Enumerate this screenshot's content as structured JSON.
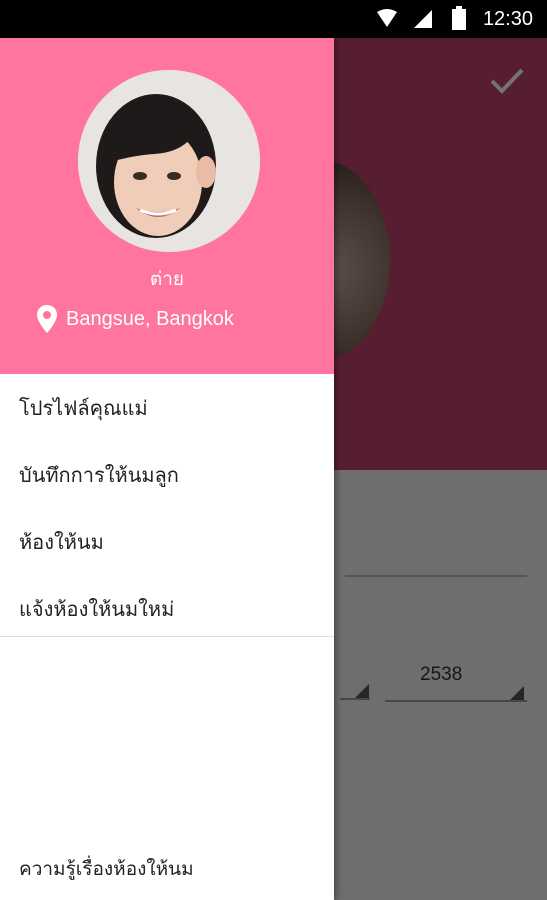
{
  "status_bar": {
    "time": "12:30"
  },
  "background": {
    "year_value": "2538"
  },
  "drawer": {
    "profile": {
      "name": "ต่าย",
      "location": "Bangsue, Bangkok"
    },
    "menu": [
      {
        "label": "โปรไฟล์คุณแม่"
      },
      {
        "label": "บันทึกการให้นมลูก"
      },
      {
        "label": "ห้องให้นม"
      },
      {
        "label": "แจ้งห้องให้นมใหม่"
      }
    ],
    "footer_item": "ความรู้เรื่องห้องให้นม"
  },
  "colors": {
    "drawer_header": "#FF759F",
    "app_header": "#C2436E"
  }
}
